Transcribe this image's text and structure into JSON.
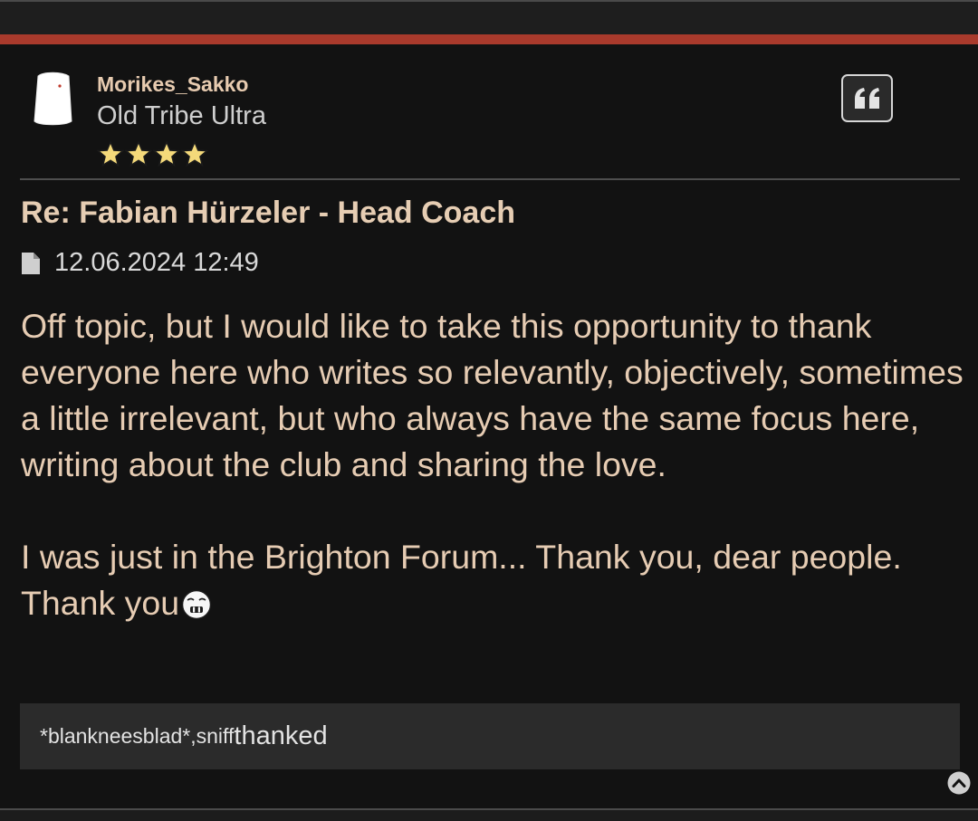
{
  "post": {
    "author": {
      "username": "Morikes_Sakko",
      "rank": "Old Tribe Ultra",
      "stars": 4,
      "avatar_icon": "avatar-image"
    },
    "quote_icon": "quote-icon",
    "title": "Re: Fabian Hürzeler - Head Coach",
    "meta_icon": "file-icon",
    "date": "12.06.2024 12:49",
    "body": {
      "paragraph_1": "Off topic, but I would like to take this opportunity to thank everyone here who writes so relevantly, objectively, sometimes a little irrelevant, but who always have the same focus here, writing about the club and sharing the love.",
      "paragraph_2": "I was just in the Brighton Forum... Thank you, dear people. Thank you"
    },
    "emoji_icon": "crying-smiley-icon"
  },
  "thanks": {
    "users": [
      "*blankneesblad*",
      "sniff"
    ],
    "separator": ",",
    "label": "thanked"
  },
  "scroll_top_icon": "chevron-up-circle-icon",
  "colors": {
    "accent_stripe": "#a93a2c",
    "text_warm": "#e6ccb3",
    "background": "#121212"
  }
}
